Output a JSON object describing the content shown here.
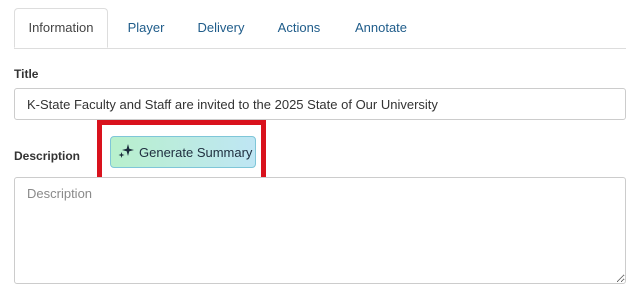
{
  "tabs": [
    {
      "label": "Information",
      "active": true
    },
    {
      "label": "Player",
      "active": false
    },
    {
      "label": "Delivery",
      "active": false
    },
    {
      "label": "Actions",
      "active": false
    },
    {
      "label": "Annotate",
      "active": false
    }
  ],
  "form": {
    "title_label": "Title",
    "title_value": "K-State Faculty and Staff are invited to the 2025 State of Our University",
    "description_label": "Description",
    "description_placeholder": "Description",
    "description_value": ""
  },
  "generate_button": {
    "label": "Generate Summary",
    "icon": "sparkles-icon"
  },
  "colors": {
    "tab_link": "#1f5c8a",
    "highlight_border": "#d9121d",
    "button_gradient_start": "#b8f0cc",
    "button_gradient_end": "#bfe6f4"
  }
}
